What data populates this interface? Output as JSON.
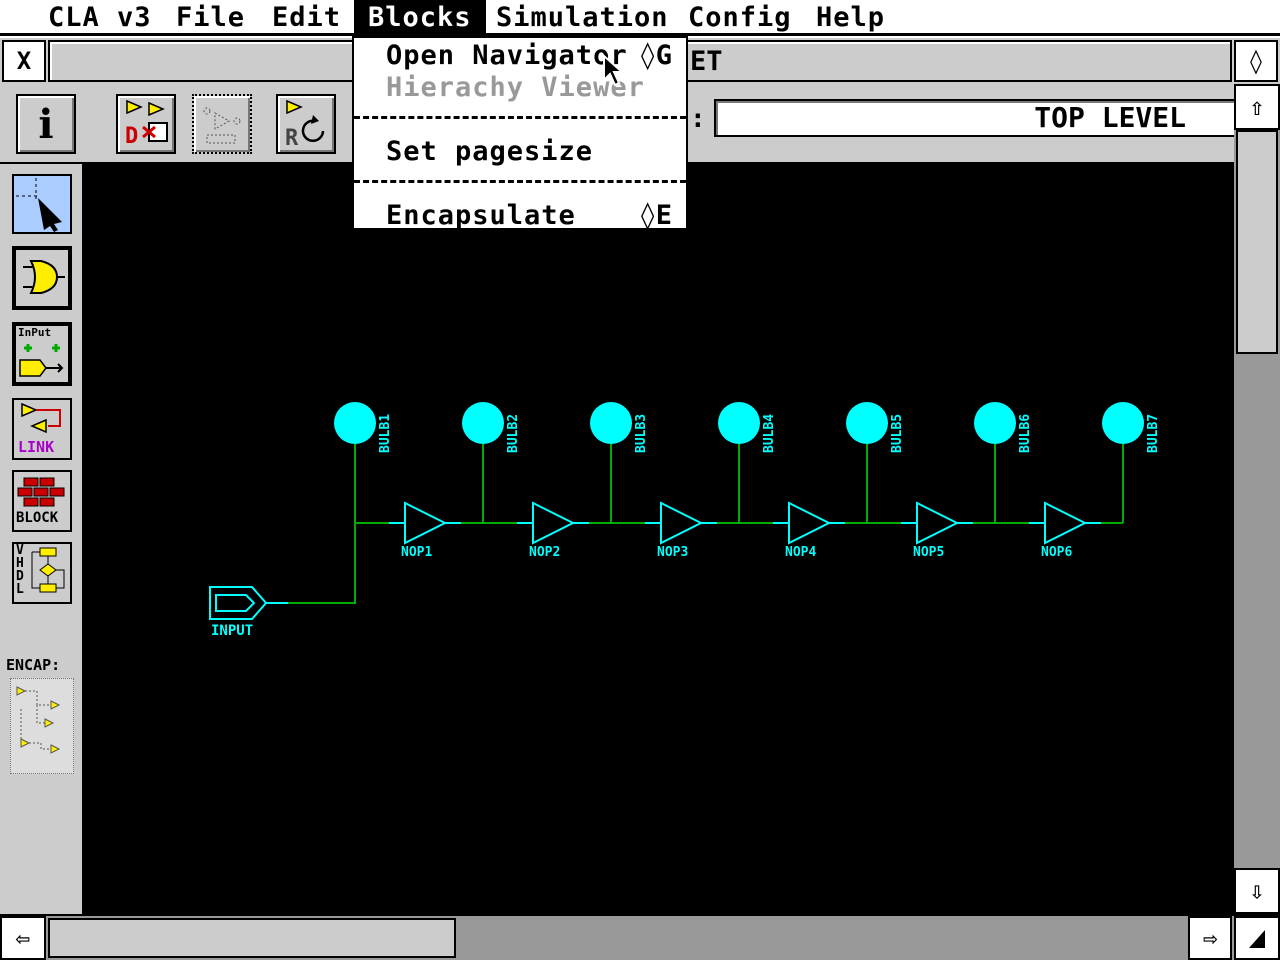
{
  "menubar": {
    "items": [
      {
        "label": "CLA v3"
      },
      {
        "label": "File"
      },
      {
        "label": "Edit"
      },
      {
        "label": "Blocks"
      },
      {
        "label": "Simulation"
      },
      {
        "label": "Config"
      },
      {
        "label": "Help"
      }
    ],
    "active": "Blocks"
  },
  "window": {
    "title_visible": "ET",
    "close_glyph": "X",
    "fullsize_glyph": "◊"
  },
  "toolbar": {
    "info_glyph": "i",
    "level_label": ":",
    "level_value": "TOP LEVEL"
  },
  "palette": {
    "encap_label": "ENCAP:",
    "input_btn_text": "InPut",
    "link_btn_text": "LINK",
    "block_btn_text": "BLOCK",
    "vhdl_btn_text": "VHDL"
  },
  "blocks_menu": {
    "items": [
      {
        "label": "Open Navigator",
        "shortcut": "◊G",
        "enabled": true
      },
      {
        "label": "Hierachy Viewer",
        "shortcut": "",
        "enabled": false
      },
      {
        "label": "Set pagesize",
        "shortcut": "",
        "enabled": true
      },
      {
        "label": "Encapsulate",
        "shortcut": "◊E",
        "enabled": true
      }
    ]
  },
  "schematic": {
    "input_label": "INPUT",
    "gates": [
      "NOP1",
      "NOP2",
      "NOP3",
      "NOP4",
      "NOP5",
      "NOP6"
    ],
    "bulbs": [
      "BULB1",
      "BULB2",
      "BULB3",
      "BULB4",
      "BULB5",
      "BULB6",
      "BULB7"
    ],
    "colors": {
      "component": "#00ffff",
      "wire": "#00aa00",
      "background": "#000000"
    }
  },
  "scroll": {
    "up_glyph": "⇧",
    "down_glyph": "⇩",
    "left_glyph": "⇦",
    "right_glyph": "⇨"
  }
}
